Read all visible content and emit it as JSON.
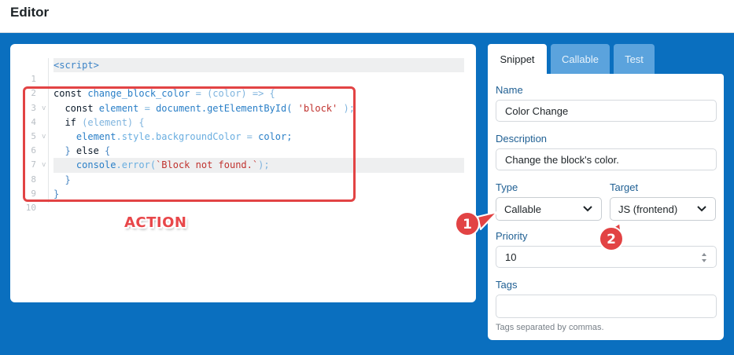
{
  "header": {
    "title": "Editor"
  },
  "code": {
    "lines": [
      {
        "num": "1",
        "fold": ""
      },
      {
        "num": "2",
        "fold": ""
      },
      {
        "num": "3",
        "fold": "v"
      },
      {
        "num": "4",
        "fold": ""
      },
      {
        "num": "5",
        "fold": "v"
      },
      {
        "num": "6",
        "fold": ""
      },
      {
        "num": "7",
        "fold": "v"
      },
      {
        "num": "8",
        "fold": ""
      },
      {
        "num": "9",
        "fold": ""
      },
      {
        "num": "10",
        "fold": ""
      }
    ],
    "tokens": {
      "l1": "<script>",
      "l3_kw": "const ",
      "l3_name": "change_block_color",
      "l3_rest": " = (color) => {",
      "l4_kw": "  const ",
      "l4_var": "element",
      "l4_eq": " = ",
      "l4_call": "document.getElementById(",
      "l4_str": " 'block'",
      "l4_end": " );",
      "l5_kw": "  if ",
      "l5_rest": "(element) {",
      "l6_obj": "    element",
      "l6_prop": ".style.backgroundColor",
      "l6_eq": " = ",
      "l6_val": "color;",
      "l7_a": "  } ",
      "l7_kw": "else",
      "l7_b": " {",
      "l8_obj": "    console",
      "l8_prop": ".error(",
      "l8_str": "`Block not found.`",
      "l8_end": ");",
      "l9": "  }",
      "l10": "}"
    }
  },
  "annotation": {
    "label": "ACTION",
    "badge1": "1",
    "badge2": "2",
    "color": "#e24344"
  },
  "tabs": [
    {
      "label": "Snippet",
      "active": true
    },
    {
      "label": "Callable",
      "active": false
    },
    {
      "label": "Test",
      "active": false
    }
  ],
  "form": {
    "name_label": "Name",
    "name_value": "Color Change",
    "description_label": "Description",
    "description_value": "Change the block's color.",
    "type_label": "Type",
    "type_value": "Callable",
    "target_label": "Target",
    "target_value": "JS (frontend)",
    "priority_label": "Priority",
    "priority_value": "10",
    "tags_label": "Tags",
    "tags_value": "",
    "tags_help": "Tags separated by commas."
  },
  "colors": {
    "background": "#0a6fbf",
    "accent": "#1f5f93",
    "tab_inactive": "#5ba3dd"
  }
}
